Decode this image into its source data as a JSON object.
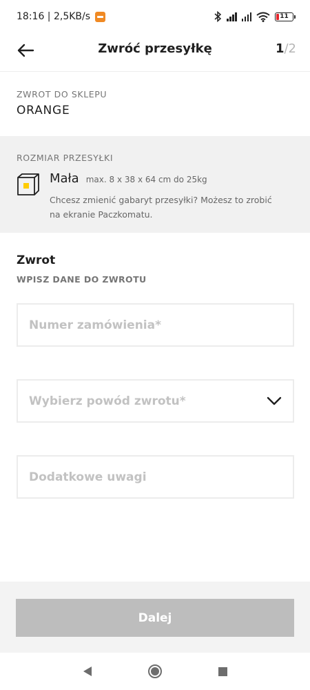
{
  "status_bar": {
    "time_speed": "18:16 | 2,5KB/s",
    "battery": "11"
  },
  "header": {
    "title": "Zwróć przesyłkę",
    "step_current": "1",
    "step_separator": "/",
    "step_total": "2"
  },
  "store": {
    "label": "ZWROT DO SKLEPU",
    "name": "ORANGE"
  },
  "size": {
    "label": "ROZMIAR PRZESYŁKI",
    "name": "Mała",
    "dimensions": "max. 8 x 38 x 64 cm do 25kg",
    "note": "Chcesz zmienić gabaryt przesyłki? Możesz to zrobić na ekranie Paczkomatu."
  },
  "form": {
    "heading": "Zwrot",
    "subheading": "WPISZ DANE DO ZWROTU",
    "order_number_placeholder": "Numer zamówienia*",
    "reason_placeholder": "Wybierz powód zwrotu*",
    "notes_placeholder": "Dodatkowe uwagi"
  },
  "footer": {
    "next_label": "Dalej"
  },
  "icons": {
    "back": "arrow-left-icon",
    "box": "parcel-box-icon",
    "chevron": "chevron-down-icon"
  },
  "colors": {
    "accent_yellow": "#ffcc00",
    "disabled_button": "#bdbdbd",
    "section_gray": "#f1f1f1",
    "battery_low": "#e4262c"
  }
}
